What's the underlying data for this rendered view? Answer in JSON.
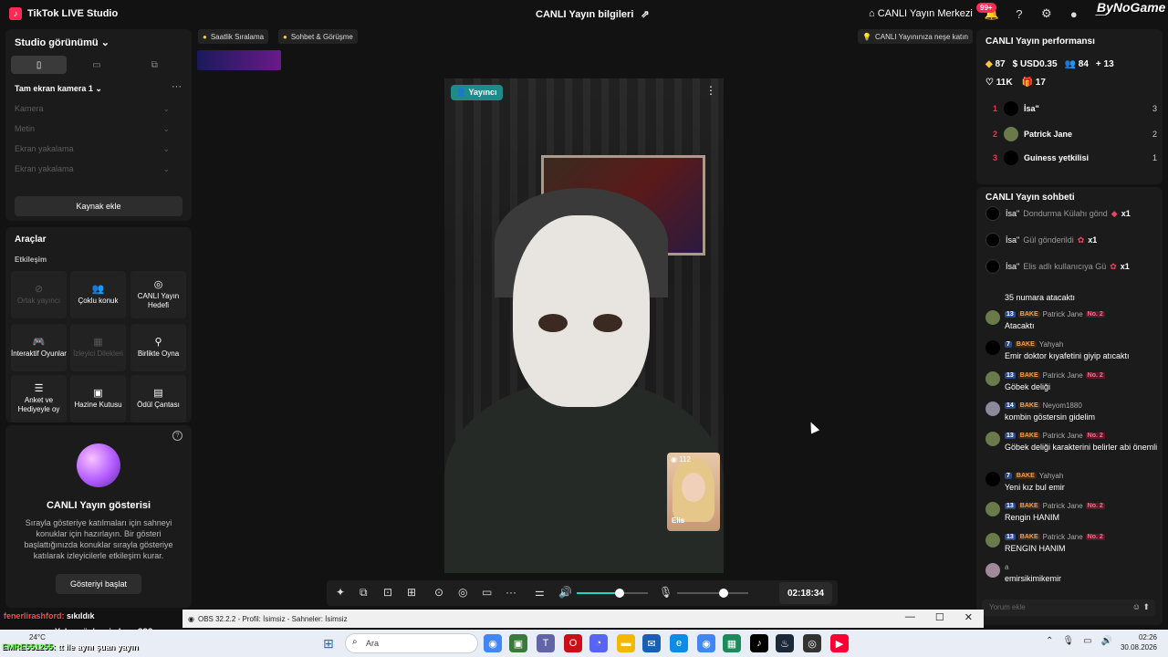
{
  "app": {
    "title": "TikTok LIVE Studio",
    "center_title": "CANLI Yayın bilgileri",
    "center_title_icon": "share-icon"
  },
  "topright": {
    "live_center": "CANLI Yayın Merkezi",
    "notif_count": "99+",
    "brand": "ByNoGame"
  },
  "studio": {
    "title": "Studio görünümü",
    "scene": "Tam ekran kamera 1",
    "sources": [
      "Kamera",
      "Metin",
      "Ekran yakalama",
      "Ekran yakalama"
    ],
    "add_source": "Kaynak ekle"
  },
  "tools": {
    "title": "Araçlar",
    "subtitle": "Etkileşim",
    "items": [
      "Ortak yayıncı",
      "Çoklu konuk",
      "CANLI Yayın Hedefi",
      "İnteraktif Oyunlar",
      "İzleyici Dilekleri",
      "Birlikte Oyna",
      "Anket ve Hediyeyle oy",
      "Hazine Kutusu",
      "Ödül Çantası"
    ]
  },
  "show": {
    "title": "CANLI Yayın gösterisi",
    "desc": "Sırayla gösteriye katılmaları için sahneyi konuklar için hazırlayın. Bir gösteri başlattığınızda konuklar sırayla gösteriye katılarak izleyicilerle etkileşim kurar.",
    "button": "Gösteriyi başlat"
  },
  "center": {
    "chip1": "Saatlik Sıralama",
    "chip2": "Sohbet & Görüşme",
    "tip": "CANLI Yayınınıza neşe katın",
    "badge": "Yayıncı",
    "guest_name": "Elis",
    "guest_count": "112",
    "timer": "02:18:34",
    "volume": 0.6,
    "mic": 0.35
  },
  "perf": {
    "title": "CANLI Yayın performansı",
    "diamonds": "87",
    "usd": "USD0.35",
    "viewers": "84",
    "new": "13",
    "likes": "11K",
    "gifts": "17",
    "ranks": [
      {
        "n": "1",
        "name": "İsa\"",
        "v": "3"
      },
      {
        "n": "2",
        "name": "Patrick Jane",
        "v": "2"
      },
      {
        "n": "3",
        "name": "Guiness yetkilisi",
        "v": "1"
      }
    ]
  },
  "chat": {
    "title": "CANLI Yayın sohbeti",
    "gifts": [
      {
        "user": "İsa\"",
        "text": "Dondurma Külahı gönd",
        "x": "x1"
      },
      {
        "user": "İsa\"",
        "text": "Gül gönderildi",
        "x": "x1"
      },
      {
        "user": "İsa\"",
        "text": "Elis adlı kullanıcıya Gü",
        "x": "x1"
      }
    ],
    "first_text": "35 numara atacaktı",
    "messages": [
      {
        "lvl": "13",
        "bake": "BAKE",
        "user": "Patrick Jane",
        "no2": "No. 2",
        "text": "Atacaktı"
      },
      {
        "lvl": "7",
        "bake": "BAKE",
        "user": "Yahyah",
        "no2": "",
        "text": "Emir doktor kıyafetini giyip atıcaktı"
      },
      {
        "lvl": "13",
        "bake": "BAKE",
        "user": "Patrick Jane",
        "no2": "No. 2",
        "text": "Göbek deliği"
      },
      {
        "lvl": "14",
        "bake": "BAKE",
        "user": "Neyom1880",
        "no2": "",
        "text": "kombin göstersin gidelim"
      },
      {
        "lvl": "13",
        "bake": "BAKE",
        "user": "Patrick Jane",
        "no2": "No. 2",
        "text": "Göbek deliği karakterini belirler abi önemli"
      },
      {
        "lvl": "7",
        "bake": "BAKE",
        "user": "Yahyah",
        "no2": "",
        "text": "Yeni kız bul emir"
      },
      {
        "lvl": "13",
        "bake": "BAKE",
        "user": "Patrick Jane",
        "no2": "No. 2",
        "text": "Rengin HANIM"
      },
      {
        "lvl": "13",
        "bake": "BAKE",
        "user": "Patrick Jane",
        "no2": "No. 2",
        "text": "RENGIN HANIM"
      },
      {
        "lvl": "",
        "bake": "",
        "user": "a",
        "no2": "",
        "text": "emirsikimikemir"
      }
    ],
    "comment_placeholder": "Yorum ekle"
  },
  "obs": {
    "title": "OBS 32.2.2 - Profil: İsimsiz - Sahneler: İsimsiz"
  },
  "overlay": [
    {
      "user": "fenerlirashford:",
      "text": "sıkıldık"
    },
    {
      "user": "",
      "text": "Yok ya öyle mi olmuş???"
    },
    {
      "user": "EMRE551255:",
      "text": "tt ile aynı şuan yayın"
    }
  ],
  "taskbar": {
    "weather": "24°C",
    "search": "Ara",
    "time": "02:26",
    "date": "30.08.2026"
  }
}
